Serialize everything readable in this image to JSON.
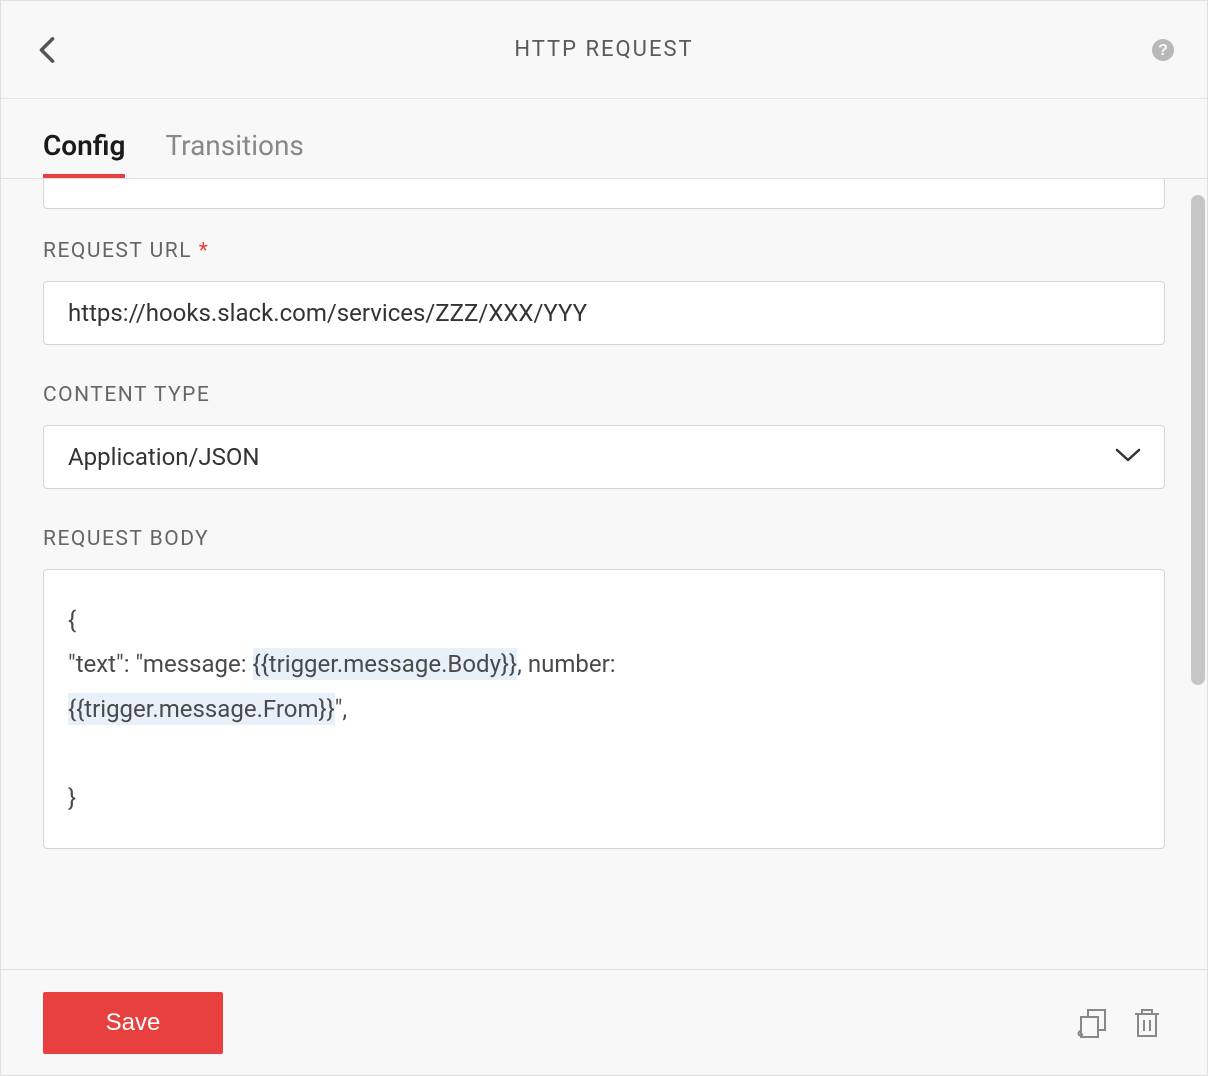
{
  "header": {
    "title": "HTTP REQUEST"
  },
  "tabs": [
    {
      "label": "Config",
      "active": true
    },
    {
      "label": "Transitions",
      "active": false
    }
  ],
  "fields": {
    "requestUrl": {
      "label": "REQUEST URL",
      "required": true,
      "value": "https://hooks.slack.com/services/ZZZ/XXX/YYY"
    },
    "contentType": {
      "label": "CONTENT TYPE",
      "value": "Application/JSON"
    },
    "requestBody": {
      "label": "REQUEST BODY",
      "line1": "{",
      "line2a": "\"text\": \"message: ",
      "line2var": "{{trigger.message.Body}}",
      "line2b": ", number: ",
      "line3var": "{{trigger.message.From}}",
      "line3a": "\",",
      "line5": "}"
    }
  },
  "footer": {
    "saveLabel": "Save"
  }
}
